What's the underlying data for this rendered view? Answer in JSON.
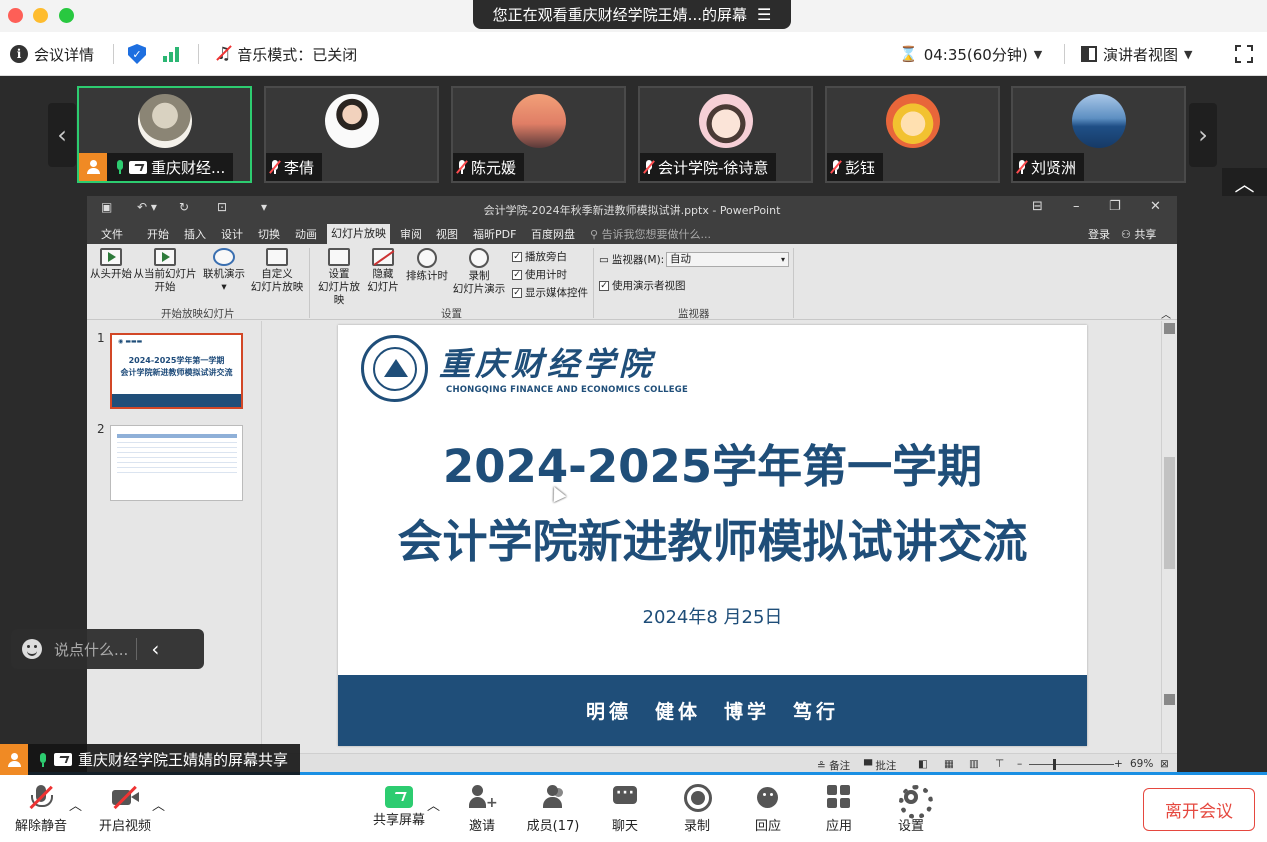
{
  "window": {
    "share_banner": "您正在观看重庆财经学院王婧...的屏幕",
    "share_banner_menu_icon": "menu-icon"
  },
  "infobar": {
    "meeting_details": "会议详情",
    "music_mode": "音乐模式：已关闭",
    "timer": "04:35(60分钟)",
    "view_mode": "演讲者视图"
  },
  "participants": [
    {
      "name": "重庆财经...",
      "is_host": true,
      "mic": "on",
      "sharing": true,
      "active": true
    },
    {
      "name": "李倩",
      "is_host": false,
      "mic": "muted",
      "sharing": false,
      "active": false
    },
    {
      "name": "陈元媛",
      "is_host": false,
      "mic": "muted",
      "sharing": false,
      "active": false
    },
    {
      "name": "会计学院-徐诗意",
      "is_host": false,
      "mic": "muted",
      "sharing": false,
      "active": false
    },
    {
      "name": "彭钰",
      "is_host": false,
      "mic": "muted",
      "sharing": false,
      "active": false
    },
    {
      "name": "刘贤洲",
      "is_host": false,
      "mic": "muted",
      "sharing": false,
      "active": false
    }
  ],
  "ppt": {
    "doc_title": "会计学院-2024年秋季新进教师模拟试讲.pptx - PowerPoint",
    "tabs": [
      "文件",
      "开始",
      "插入",
      "设计",
      "切换",
      "动画",
      "幻灯片放映",
      "审阅",
      "视图",
      "福昕PDF",
      "百度网盘"
    ],
    "active_tab": "幻灯片放映",
    "tell_me": "告诉我您想要做什么...",
    "login": "登录",
    "share": "共享",
    "ribbon": {
      "from_beginning": "从头开始",
      "from_current_1": "从当前幻灯片",
      "from_current_2": "开始",
      "online": "联机演示",
      "custom_1": "自定义",
      "custom_2": "幻灯片放映",
      "group_start": "开始放映幻灯片",
      "setup_1": "设置",
      "setup_2": "幻灯片放映",
      "hide_1": "隐藏",
      "hide_2": "幻灯片",
      "rehearse": "排练计时",
      "record_1": "录制",
      "record_2": "幻灯片演示",
      "cb_narration": "播放旁白",
      "cb_timing": "使用计时",
      "cb_media": "显示媒体控件",
      "group_setup": "设置",
      "monitor_label": "监视器(M):",
      "monitor_value": "自动",
      "cb_presenter": "使用演示者视图",
      "group_monitor": "监视器"
    },
    "thumbnails": [
      {
        "num": "1",
        "title_1": "2024-2025学年第一学期",
        "title_2": "会计学院新进教师模拟试讲交流"
      },
      {
        "num": "2"
      }
    ],
    "slide": {
      "college_cn": "重庆财经学院",
      "college_en": "CHONGQING FINANCE AND ECONOMICS COLLEGE",
      "title_1": "2024-2025学年第一学期",
      "title_2": "会计学院新进教师模拟试讲交流",
      "date": "2024年8 月25日",
      "motto": "明德　健体　博学　笃行"
    },
    "status": {
      "notes": "备注",
      "comments": "批注",
      "zoom": "69%"
    }
  },
  "chat": {
    "placeholder": "说点什么..."
  },
  "sharer": {
    "label": "重庆财经学院王婧婧的屏幕共享"
  },
  "toolbar": {
    "unmute": "解除静音",
    "start_video": "开启视频",
    "share_screen": "共享屏幕",
    "invite": "邀请",
    "members": "成员(17)",
    "chat": "聊天",
    "record": "录制",
    "react": "回应",
    "apps": "应用",
    "settings": "设置",
    "leave": "离开会议"
  },
  "colors": {
    "accent_green": "#2dcc70",
    "slide_blue": "#1f4e79",
    "leave_red": "#e5483f",
    "host_orange": "#f08a24"
  }
}
